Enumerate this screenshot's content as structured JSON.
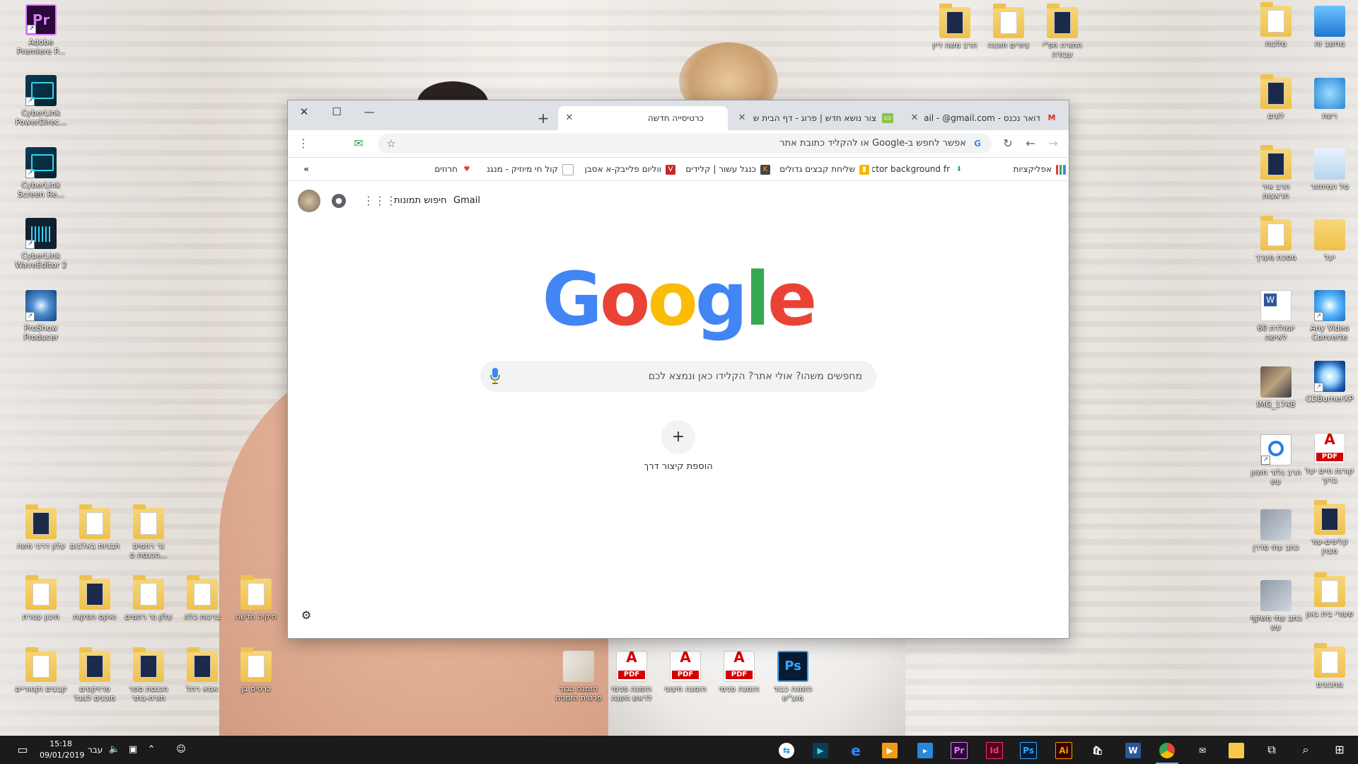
{
  "desktop": {
    "left_icons": [
      {
        "label": "Adobe Premiere P...",
        "icon": "premiere-icon"
      },
      {
        "label": "CyberLink PowerDirec...",
        "icon": "powerdirector-icon"
      },
      {
        "label": "CyberLink Screen Re...",
        "icon": "screen-recorder-icon"
      },
      {
        "label": "CyberLink WaveEditor 2",
        "icon": "wave-editor-icon"
      },
      {
        "label": "ProShow Producer",
        "icon": "proshow-icon"
      }
    ],
    "left_folders_row1": [
      "עלון דרכי משה",
      "תבניות באלבום",
      "נר רחמים הכנסת ס..."
    ],
    "left_folders_row2": [
      "תיכון עטרת",
      "ואקס הפקות",
      "עלון נר רחמים",
      "ברכות כלה",
      "תיקיה חדשה"
    ],
    "left_folders_row3": [
      "קבצים וקטוריים",
      "פרויקטים מוכנים לגוגל",
      "הכנסת ספר תורה-בתר",
      "אמא רחל",
      "כרטיס בן"
    ],
    "bottom_icons": [
      {
        "label": "הזמנה כבוד פרטית הזמניה",
        "icon": "image-file-icon"
      },
      {
        "label": "הזמנה פנימי לראש השנה",
        "icon": "pdf-icon"
      },
      {
        "label": "הזמנה חיצוני",
        "icon": "pdf-icon"
      },
      {
        "label": "הזמנה פנימי",
        "icon": "pdf-icon"
      },
      {
        "label": "הזמנה כבוד מוצ\"ש",
        "icon": "psd-icon"
      }
    ],
    "top_icons": [
      "הרב משה דיין",
      "ציורים תוכנה",
      "התורה חפ\"י עבודה"
    ],
    "right_col1": [
      {
        "label": "מחשב זה",
        "icon": "this-pc-icon"
      },
      {
        "label": "רשת",
        "icon": "network-icon"
      },
      {
        "label": "סל המיחזור",
        "icon": "recycle-bin-icon"
      },
      {
        "label": "יעל",
        "icon": "user-folder-icon"
      },
      {
        "label": "Any Video Converte",
        "icon": "any-video-converter-icon"
      },
      {
        "label": "CDBurnerXP",
        "icon": "cdburner-icon"
      },
      {
        "label": "קורות חיים יעל ברוך",
        "icon": "pdf-icon"
      },
      {
        "label": "קליפים-עוד מצוין",
        "icon": "folder-icon"
      },
      {
        "label": "שעורי בית גאון",
        "icon": "folder-icon"
      },
      {
        "label": "מתכונים",
        "icon": "folder-icon"
      }
    ],
    "right_col2": [
      {
        "label": "מלכות",
        "icon": "folder-icon"
      },
      {
        "label": "לוגים",
        "icon": "folder-icon"
      },
      {
        "label": "הרב איר חראצות",
        "icon": "folder-icon"
      },
      {
        "label": "מסכת מערך",
        "icon": "folder-icon"
      },
      {
        "label": "יומולדת 60 לאישה",
        "icon": "word-doc-icon"
      },
      {
        "label": "IMG_1748",
        "icon": "photo-icon"
      },
      {
        "label": "הרב גלזר חשוון עש",
        "icon": "ribbon-icon"
      },
      {
        "label": "כתב עתי סדרן",
        "icon": "image-file-icon"
      },
      {
        "label": "כתב עתי משקף עש",
        "icon": "image-file-icon"
      }
    ]
  },
  "chrome": {
    "tabs": [
      {
        "title": "דואר נכנס - Gmail - @gmail.com",
        "favicon": "gmail-icon",
        "active": false
      },
      {
        "title": "צור נושא חדש | פרוג - דף הבית ש",
        "favicon": "prog-icon",
        "active": false
      },
      {
        "title": "כרטיסייה חדשה",
        "favicon": "",
        "active": true
      }
    ],
    "new_tab": "+",
    "window_controls": {
      "minimize": "—",
      "maximize": "☐",
      "close": "✕"
    },
    "omnibox_placeholder": "אפשר לחפש ב-Google או להקליד כתובת אתר",
    "bookmarks": [
      {
        "label": "אפליקציות",
        "icon": "apps-grid-icon",
        "color": "#e8453c"
      },
      {
        "label": "Vector background fr",
        "icon": "download-icon",
        "color": "#34a853"
      },
      {
        "label": "שליחת קבצים גדולים",
        "icon": "bookmark-icon",
        "color": "#f7b500"
      },
      {
        "label": "כנגל עשור | קלידים",
        "icon": "k-icon",
        "color": "#444444"
      },
      {
        "label": "ווליום פלייבק-א אסבן",
        "icon": "v-icon",
        "color": "#c62828"
      },
      {
        "label": "קול חי מיוזיק - מנגנ",
        "icon": "page-icon",
        "color": "#9e9e9e"
      },
      {
        "label": "חרוזים",
        "icon": "heart-icon",
        "color": "#e53935"
      }
    ],
    "bookmarks_overflow": "»",
    "ntp": {
      "gmail_link": "Gmail",
      "images_link": "חיפוש תמונות",
      "logo_letters": [
        {
          "ch": "G",
          "color": "#4285f4"
        },
        {
          "ch": "o",
          "color": "#ea4335"
        },
        {
          "ch": "o",
          "color": "#fbbc05"
        },
        {
          "ch": "g",
          "color": "#4285f4"
        },
        {
          "ch": "l",
          "color": "#34a853"
        },
        {
          "ch": "e",
          "color": "#ea4335"
        }
      ],
      "search_placeholder": "מחפשים משהו? אולי אתר? הקלידו כאן ונמצא לכם",
      "add_shortcut_label": "הוספת קיצור דרך",
      "add_shortcut_symbol": "+"
    }
  },
  "taskbar": {
    "clock_time": "15:18",
    "clock_date": "09/01/2019",
    "language": "עבר",
    "apps": [
      "teamviewer-icon",
      "powerdirector-icon",
      "edge-icon",
      "media-player-icon",
      "onenote-icon",
      "premiere-icon",
      "indesign-icon",
      "photoshop-icon",
      "illustrator-icon",
      "store-icon",
      "word-icon",
      "chrome-icon",
      "mail-icon",
      "file-explorer-icon",
      "task-view-icon",
      "search-icon",
      "start-icon"
    ],
    "app_letters": {
      "premiere": "Pr",
      "indesign": "Id",
      "photoshop": "Ps",
      "illustrator": "Ai"
    }
  }
}
